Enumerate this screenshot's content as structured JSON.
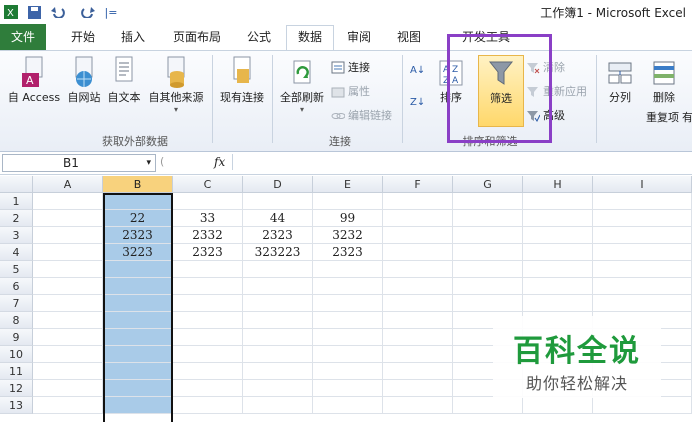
{
  "window": {
    "title": "工作簿1 - Microsoft Excel"
  },
  "quick_access": {
    "excel_icon": "excel-icon",
    "save_icon": "save-icon",
    "undo_icon": "undo-icon",
    "redo_icon": "redo-icon",
    "customize_glyph": "|="
  },
  "tabs": [
    "文件",
    "开始",
    "插入",
    "页面布局",
    "公式",
    "数据",
    "审阅",
    "视图",
    "开发工具"
  ],
  "ribbon": {
    "external_data": {
      "group_label": "获取外部数据",
      "buttons": [
        "自 Access",
        "自网站",
        "自文本",
        "自其他来源",
        "现有连接"
      ]
    },
    "connections": {
      "group_label": "连接",
      "refresh_all": "全部刷新",
      "connections": "连接",
      "properties": "属性",
      "edit_links": "编辑链接"
    },
    "sort_filter": {
      "group_label": "排序和筛选",
      "sort": "排序",
      "filter": "筛选",
      "clear": "清除",
      "reapply": "重新应用",
      "advanced": "高级"
    },
    "data_tools": {
      "split": "分列",
      "remove_duplicates_line1": "删除",
      "remove_duplicates_line2": "重复项",
      "cut_glyph": "有"
    }
  },
  "formula_bar": {
    "name_box": "B1",
    "fx": "fx",
    "value": ""
  },
  "sheet": {
    "columns": [
      "A",
      "B",
      "C",
      "D",
      "E",
      "F",
      "G",
      "H",
      "I"
    ],
    "rows": [
      "1",
      "2",
      "3",
      "4",
      "5",
      "6",
      "7",
      "8",
      "9",
      "10",
      "11",
      "12",
      "13"
    ],
    "selected_column": "B",
    "cells": {
      "r2": {
        "B": "22",
        "C": "33",
        "D": "44",
        "E": "99"
      },
      "r3": {
        "B": "2323",
        "C": "2332",
        "D": "2323",
        "E": "3232"
      },
      "r4": {
        "B": "3223",
        "C": "2323",
        "D": "323223",
        "E": "2323"
      }
    }
  },
  "watermark": {
    "title": "百科全说",
    "subtitle": "助你轻松解决"
  },
  "colors": {
    "file_tab": "#2f7d3b",
    "selection": "#a9cbe8",
    "highlight": "#8a3fc6",
    "watermark_green": "#1f9a3c"
  }
}
